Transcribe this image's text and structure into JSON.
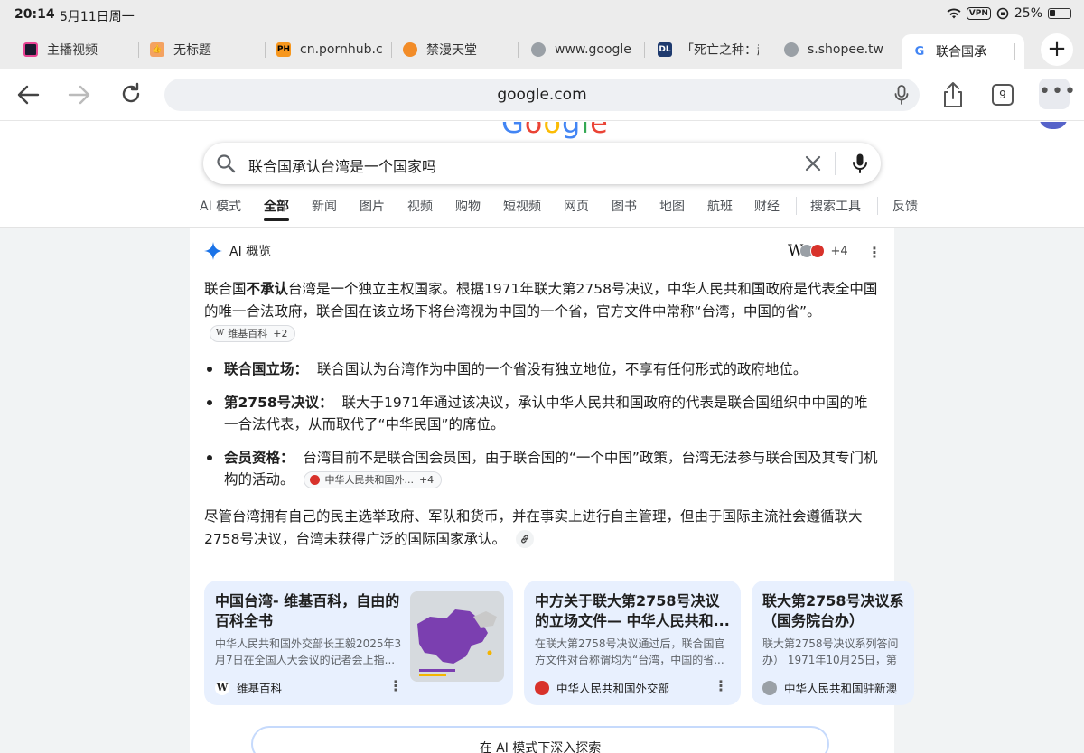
{
  "status_bar": {
    "time": "20:14",
    "date": "5月11日周一",
    "vpn": "VPN",
    "battery": "25%"
  },
  "tabs": [
    {
      "title": "主播视频",
      "fav_color": "#1a1a2e"
    },
    {
      "title": "无标题",
      "fav_color": "#f4a261"
    },
    {
      "title": "cn.pornhub.c",
      "fav_label": "PH",
      "fav_color": "#f7971e"
    },
    {
      "title": "禁漫天堂",
      "fav_color": "#f28c28"
    },
    {
      "title": "www.google",
      "fav_color": "#9aa0a6"
    },
    {
      "title": "「死亡之种：起",
      "fav_label": "DL",
      "fav_color": "#1e3a6e"
    },
    {
      "title": "s.shopee.tw",
      "fav_color": "#9aa0a6"
    },
    {
      "title": "联合国承",
      "fav_label": "G",
      "active": true
    }
  ],
  "toolbar": {
    "url": "google.com",
    "tab_count": "9"
  },
  "search": {
    "query": "联合国承认台湾是一个国家吗"
  },
  "filters": [
    "AI 模式",
    "全部",
    "新闻",
    "图片",
    "视频",
    "购物",
    "短视频",
    "网页",
    "图书",
    "地图",
    "航班",
    "财经",
    "搜索工具",
    "反馈"
  ],
  "active_filter": "全部",
  "ai_overview": {
    "label": "AI 概览",
    "sources_more": "+4",
    "intro_a": "联合国",
    "intro_bold": "不承认",
    "intro_b": "台湾是一个独立主权国家。根据1971年联大第2758号决议，中华人民共和国政府是代表全中国的唯一合法政府，联合国在该立场下将台湾视为中国的一个省，官方文件中常称“台湾，中国的省”。",
    "intro_chip": "维基百科",
    "intro_chip_more": "+2",
    "bullets": [
      {
        "title": "联合国立场：",
        "text": "联合国认为台湾作为中国的一个省没有独立地位，不享有任何形式的政府地位。"
      },
      {
        "title": "第2758号决议：",
        "text": "联大于1971年通过该决议，承认中华人民共和国政府的代表是联合国组织中中国的唯一合法代表，从而取代了“中华民国”的席位。"
      },
      {
        "title": "会员资格：",
        "text": "台湾目前不是联合国会员国，由于联合国的“一个中国”政策，台湾无法参与联合国及其专门机构的活动。",
        "chip": "中华人民共和国外...",
        "chip_more": "+4"
      }
    ],
    "closing": "尽管台湾拥有自己的民主选举政府、军队和货币，并在事实上进行自主管理，但由于国际主流社会遵循联大2758号决议，台湾未获得广泛的国际国家承认。"
  },
  "cards": [
    {
      "title": "中国台湾- 维基百科，自由的百科全书",
      "snippet": "中华人民共和国外交部长王毅2025年3月7日在全国人大会议的记者会上指...",
      "source": "维基百科"
    },
    {
      "title": "中方关于联大第2758号决议的立场文件— 中华人民共和...",
      "snippet": "在联大第2758号决议通过后，联合国官方文件对台称谓均为“台湾，中国的省...",
      "source": "中华人民共和国外交部"
    },
    {
      "title": "联大第2758号决议系（国务院台办）",
      "snippet": "联大第2758号决议系列答问办） 1971年10月25日，第",
      "source": "中华人民共和国驻新澳"
    }
  ],
  "explore_button": "在 AI 模式下深入探索",
  "colors": {
    "accent": "#1a73e8",
    "card_bg": "#e8f0fe"
  }
}
